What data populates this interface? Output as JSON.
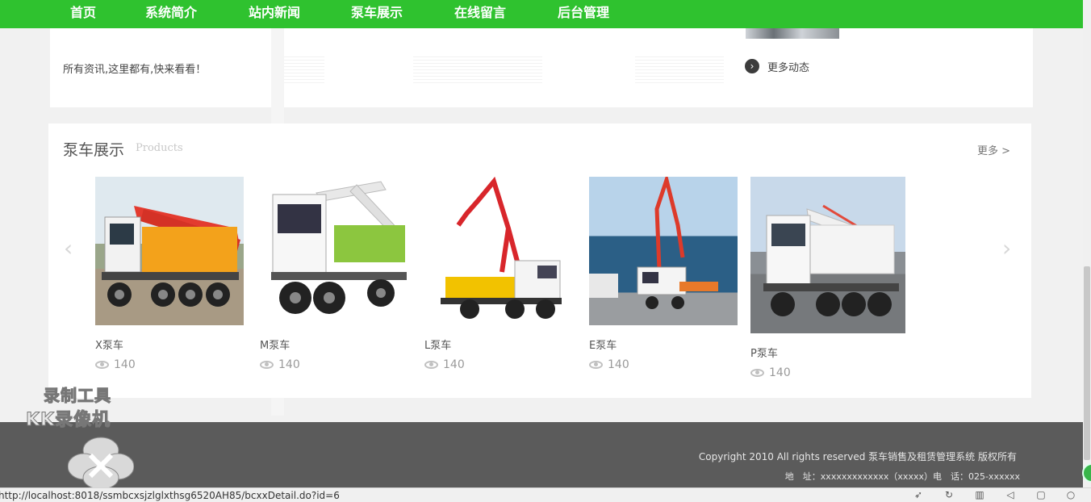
{
  "nav": {
    "items": [
      {
        "label": "首页"
      },
      {
        "label": "系统简介"
      },
      {
        "label": "站内新闻"
      },
      {
        "label": "泵车展示"
      },
      {
        "label": "在线留言"
      },
      {
        "label": "后台管理"
      }
    ]
  },
  "news": {
    "description": "所有资讯,这里都有,快来看看！",
    "more_label": "更多动态",
    "more_icon": "chevron-right-circle-icon"
  },
  "products": {
    "title": "泵车展示",
    "subtitle": "Products",
    "more_label": "更多 >",
    "prev_icon": "chevron-left-icon",
    "next_icon": "chevron-right-icon",
    "items": [
      {
        "name": "X泵车",
        "views": "140",
        "boom_color": "#e33b2f",
        "body_color": "#f3a21b"
      },
      {
        "name": "M泵车",
        "views": "140",
        "boom_color": "#e8e8e8",
        "body_color": "#8cc63f"
      },
      {
        "name": "L泵车",
        "views": "140",
        "boom_color": "#d8262b",
        "body_color": "#f2c200"
      },
      {
        "name": "E泵车",
        "views": "140",
        "boom_color": "#dd3a2a",
        "body_color": "#e8792a"
      },
      {
        "name": "P泵车",
        "views": "140",
        "boom_color": "#e24a3b",
        "body_color": "#f4f4f4"
      }
    ]
  },
  "footer": {
    "copyright": "Copyright 2010 All rights reserved 泵车销售及租赁管理系统 版权所有",
    "address": "地　址：xxxxxxxxxxxxx（xxxxx）电　话：025-xxxxxx"
  },
  "watermark": {
    "line1": "录制工具",
    "line2": "KK录像机"
  },
  "statusbar": {
    "url": "http://localhost:8018/ssmbcxsjzlglxthsg6520AH85/bcxxDetail.do?id=6"
  },
  "colors": {
    "nav_green": "#2fc22f",
    "footer_gray": "#5b5b5b"
  }
}
